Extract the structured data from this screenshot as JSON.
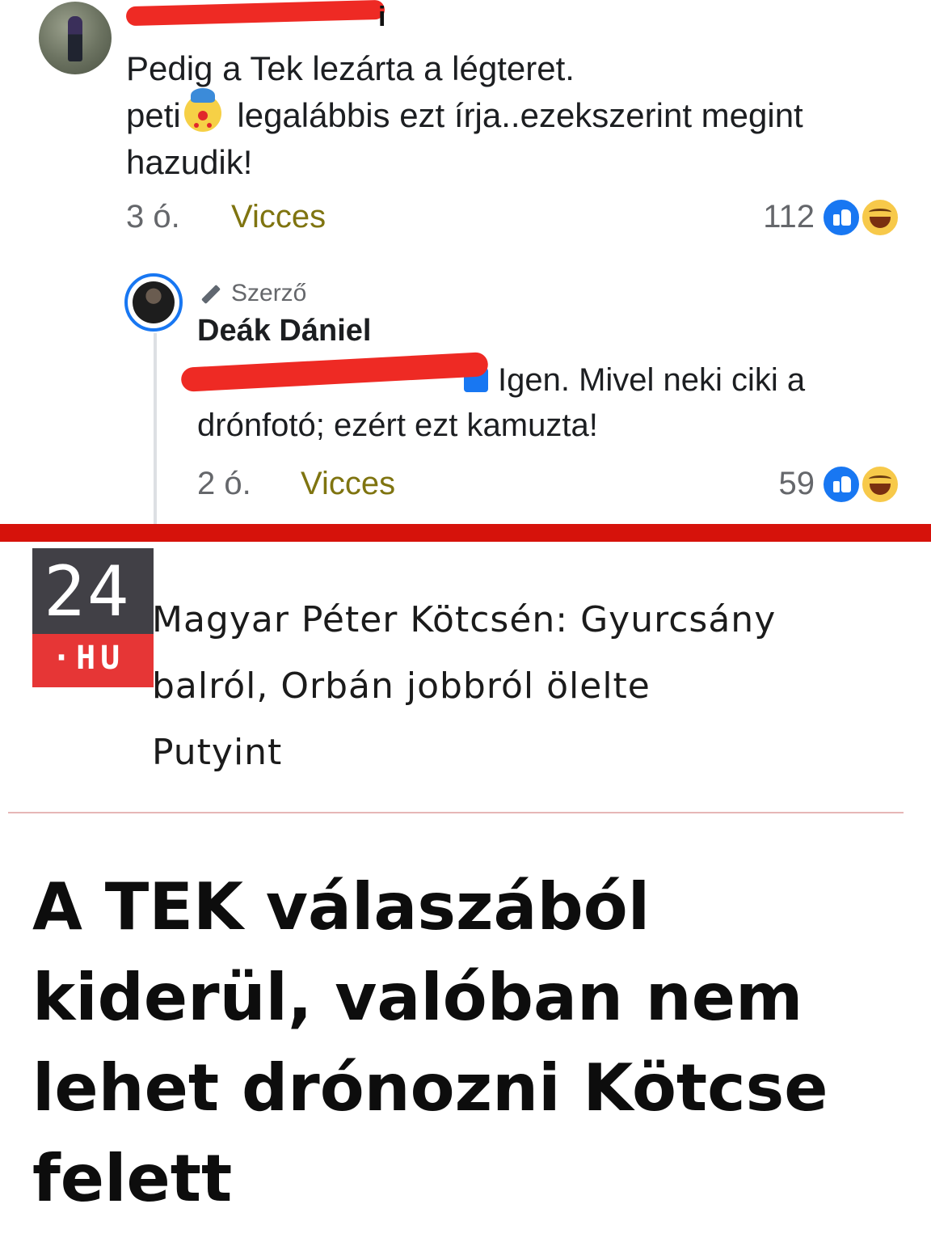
{
  "comment1": {
    "author_visible_suffix": "i",
    "text_line1": "Pedig a Tek lezárta a légteret.",
    "text_line2_before": "peti",
    "text_line2_after": " legalábbis ezt írja..ezekszerint megint",
    "text_line3": "hazudik!",
    "time": "3 ó.",
    "reaction_label": "Vicces",
    "reaction_count": "112",
    "icons": [
      "clown-emoji",
      "like-icon",
      "haha-icon"
    ]
  },
  "reply": {
    "badge": "Szerző",
    "author": "Deák Dániel",
    "text_line1": "Igen. Mivel neki ciki a",
    "text_line2": "drónfotó; ezért ezt kamuzta!",
    "time": "2 ó.",
    "reaction_label": "Vicces",
    "reaction_count": "59"
  },
  "logo": {
    "number": "24",
    "domain": "·HU"
  },
  "article": {
    "link_line1": "Magyar Péter Kötcsén: Gyurcsány",
    "link_line2": "balról, Orbán jobbról ölelte",
    "link_line3": "Putyint",
    "headline_line1": "A TEK válaszából",
    "headline_line2": "kiderül, valóban nem",
    "headline_line3": "lehet drónozni Kötcse",
    "headline_line4": "felett"
  },
  "colors": {
    "accent_red": "#d6120b",
    "reaction_text": "#7f7410",
    "facebook_blue": "#1877f2",
    "logo_dark": "#414046",
    "logo_red": "#e63636"
  }
}
